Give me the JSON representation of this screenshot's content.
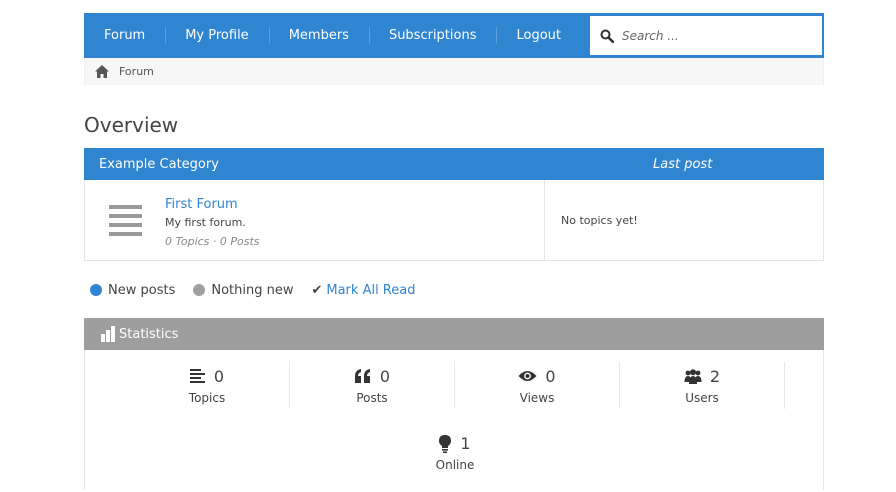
{
  "nav": {
    "items": [
      "Forum",
      "My Profile",
      "Members",
      "Subscriptions",
      "Logout"
    ],
    "search_placeholder": "Search ..."
  },
  "breadcrumb": {
    "current": "Forum"
  },
  "page": {
    "title": "Overview"
  },
  "category": {
    "name": "Example Category",
    "last_post_header": "Last post",
    "forums": [
      {
        "title": "First Forum",
        "description": "My first forum.",
        "meta": "0 Topics · 0 Posts",
        "last_post": "No topics yet!"
      }
    ]
  },
  "legend": {
    "new_posts": "New posts",
    "nothing_new": "Nothing new",
    "mark_all_read": "Mark All Read",
    "new_color": "#3085d0",
    "nothing_color": "#a0a0a0"
  },
  "statistics": {
    "title": "Statistics",
    "items": [
      {
        "icon": "list-icon",
        "value": "0",
        "label": "Topics"
      },
      {
        "icon": "quote-icon",
        "value": "0",
        "label": "Posts"
      },
      {
        "icon": "eye-icon",
        "value": "0",
        "label": "Views"
      },
      {
        "icon": "users-icon",
        "value": "2",
        "label": "Users"
      }
    ],
    "online": {
      "icon": "lightbulb-icon",
      "value": "1",
      "label": "Online"
    }
  },
  "colors": {
    "accent": "#3085d0",
    "stats_header": "#9e9e9e"
  }
}
